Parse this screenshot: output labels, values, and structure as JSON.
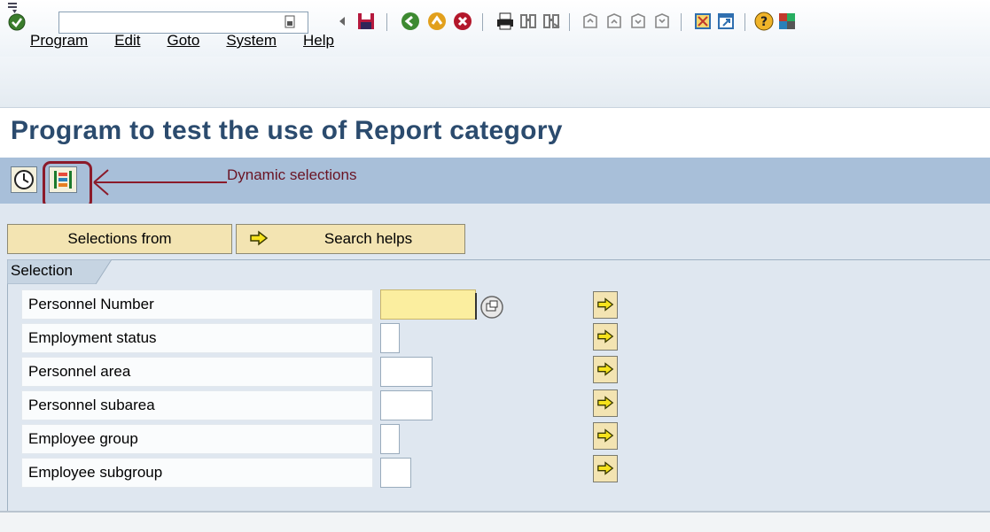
{
  "menu": {
    "items": [
      "Program",
      "Edit",
      "Goto",
      "System",
      "Help"
    ]
  },
  "toolbar": {
    "command_field_value": "",
    "icons": [
      "enter-icon",
      "back-arrow-icon",
      "save-icon",
      "back-icon",
      "exit-icon",
      "cancel-icon",
      "print-icon",
      "find-icon",
      "find-next-icon",
      "first-page-icon",
      "previous-page-icon",
      "next-page-icon",
      "last-page-icon",
      "create-session-icon",
      "shortcut-icon",
      "help-icon",
      "customize-layout-icon"
    ]
  },
  "page": {
    "title": "Program to test the use of Report category"
  },
  "app_toolbar": {
    "annotation": "Dynamic selections"
  },
  "buttons": {
    "selections_from": "Selections from",
    "search_helps": "Search helps"
  },
  "selection": {
    "frame_title": "Selection",
    "rows": [
      {
        "label": "Personnel Number",
        "value": ""
      },
      {
        "label": "Employment status",
        "value": ""
      },
      {
        "label": "Personnel area",
        "value": ""
      },
      {
        "label": "Personnel subarea",
        "value": ""
      },
      {
        "label": "Employee group",
        "value": ""
      },
      {
        "label": "Employee subgroup",
        "value": ""
      }
    ]
  },
  "colors": {
    "title": "#2b4b6e",
    "app_toolbar": "#a8bfd9",
    "body_background": "#dfe7f0",
    "button_background": "#f3e4b2",
    "required_field": "#fbee9f",
    "annotation": "#8b1a2a"
  }
}
